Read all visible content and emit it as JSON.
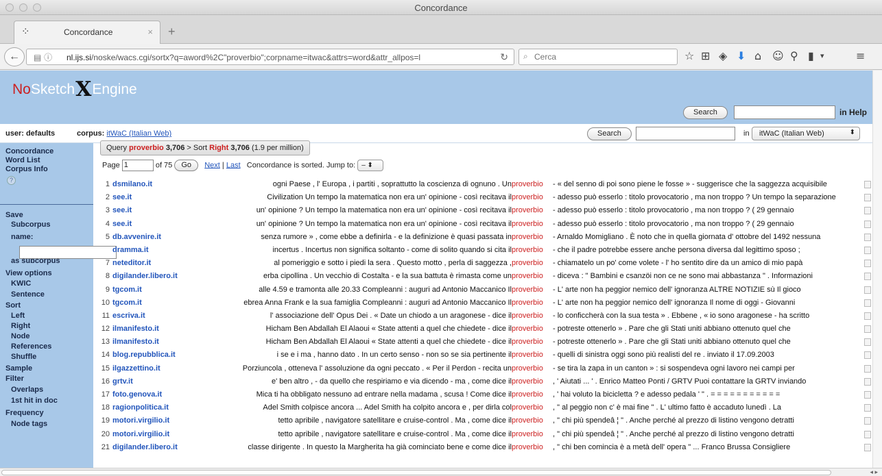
{
  "window": {
    "title": "Concordance"
  },
  "tab": {
    "favicon": "⁘",
    "label": "Concordance",
    "close": "×",
    "new": "+"
  },
  "nav": {
    "back": "←",
    "url_icons": "▤ ⓘ",
    "url_host": "nl.ijs.si",
    "url_path": "/noske/wacs.cgi/sortx?q=aword%2C\"proverbio\";corpname=itwac&attrs=word&attr_allpos=l",
    "reload": "↻",
    "search_placeholder": "Cerca",
    "search_icon": "⌕",
    "tools": [
      "☆",
      "⊞",
      "◈",
      "⬇",
      "⌂",
      "☺",
      "⚲",
      "▮",
      "▾",
      "≡"
    ]
  },
  "header": {
    "logo_no": "No",
    "logo_sketch": "Sketch",
    "logo_x": "X",
    "logo_engine": "Engine",
    "help_search_button": "Search",
    "help_label": "in Help"
  },
  "userbar": {
    "user": "user: defaults",
    "corpus_label": "corpus:",
    "corpus_name": "itWaC (Italian Web)",
    "search_button": "Search",
    "in_label": "in",
    "corpus_select": "itWaC (Italian Web)",
    "select_arrow": "⬍"
  },
  "sidebar": {
    "concordance": "Concordance",
    "word_list": "Word List",
    "corpus_info": "Corpus Info",
    "help": "?",
    "save": "Save",
    "subcorpus": "Subcorpus",
    "name": "name:",
    "as_subcorpus": "as subcorpus",
    "view_options": "View options",
    "kwic": "KWIC",
    "sentence": "Sentence",
    "sort": "Sort",
    "left": "Left",
    "right": "Right",
    "node": "Node",
    "references": "References",
    "shuffle": "Shuffle",
    "sample": "Sample",
    "filter": "Filter",
    "overlaps": "Overlaps",
    "first_hit": "1st hit in doc",
    "frequency": "Frequency",
    "node_tags": "Node tags"
  },
  "query": {
    "query_label": "Query",
    "query_word": "proverbio",
    "query_count": "3,706",
    "arrow": ">",
    "sort_label": "Sort",
    "sort_word": "Right",
    "sort_count": "3,706",
    "per_million": "(1.9 per million)"
  },
  "pager": {
    "page_label": "Page",
    "page_value": "1",
    "of_label": "of 75",
    "go": "Go",
    "next": "Next",
    "sep": "|",
    "last": "Last",
    "sorted_text": "Concordance is sorted. Jump to:",
    "jump_value": "– ⬍"
  },
  "rows": [
    {
      "n": "1",
      "ref": "dsmilano.it",
      "left": "ogni Paese , l' Europa , i partiti , soprattutto la coscienza di ognuno . Un",
      "kw": "proverbio",
      "right": "- « del senno di poi sono piene le fosse » - suggerisce che la saggezza acquisibile"
    },
    {
      "n": "2",
      "ref": "see.it",
      "left": "Civilization Un tempo la matematica non era un' opinione - così recitava il",
      "kw": "proverbio",
      "right": "- adesso può esserlo : titolo provocatorio , ma non troppo ? Un tempo la separazione"
    },
    {
      "n": "3",
      "ref": "see.it",
      "left": "un' opinione ? Un tempo la matematica non era un' opinione - così recitava il",
      "kw": "proverbio",
      "right": "- adesso può esserlo : titolo provocatorio , ma non troppo ? ( 29 gennaio"
    },
    {
      "n": "4",
      "ref": "see.it",
      "left": "un' opinione ? Un tempo la matematica non era un' opinione - così recitava il",
      "kw": "proverbio",
      "right": "- adesso può esserlo : titolo provocatorio , ma non troppo ? ( 29 gennaio"
    },
    {
      "n": "5",
      "ref": "db.avvenire.it",
      "left": "senza rumore » , come ebbe a definirla - e la definizione è quasi passata in",
      "kw": "proverbio",
      "right": "- Arnaldo Momigliano . È noto che in quella giornata d' ottobre del 1492 nessuna"
    },
    {
      "n": "",
      "ref": "dramma.it",
      "left": "incertus . Incertus non significa soltanto - come di solito quando si cita il",
      "kw": "proverbio",
      "right": "- che il padre potrebbe essere anche persona diversa dal legittimo sposo ;"
    },
    {
      "n": "7",
      "ref": "neteditor.it",
      "left": "al pomeriggio e sotto i piedi la sera . Questo motto , perla di saggezza ,",
      "kw": "proverbio",
      "right": "- chiamatelo un po' come volete - l' ho sentito dire da un amico di mio papà"
    },
    {
      "n": "8",
      "ref": "digilander.libero.it",
      "left": "erba cipollina . Un vecchio di Costalta - e la sua battuta è rimasta come un",
      "kw": "proverbio",
      "right": "- diceva : \" Bambini e csanzöi non ce ne sono mai abbastanza \" . Informazioni"
    },
    {
      "n": "9",
      "ref": "tgcom.it",
      "left": "alle 4.59 e tramonta alle 20.33 Compleanni : auguri ad Antonio Maccanico Il",
      "kw": "proverbio",
      "right": "- L' arte non ha peggior nemico dell' ignoranza ALTRE NOTIZIE sù Il gioco"
    },
    {
      "n": "10",
      "ref": "tgcom.it",
      "left": "ebrea Anna Frank e la sua famiglia Compleanni : auguri ad Antonio Maccanico Il",
      "kw": "proverbio",
      "right": "- L' arte non ha peggior nemico dell' ignoranza Il nome di oggi - Giovanni"
    },
    {
      "n": "11",
      "ref": "escriva.it",
      "left": "l' associazione dell' Opus Dei . « Date un chiodo a un aragonese - dice il",
      "kw": "proverbio",
      "right": "- lo conficcherà con la sua testa » . Ebbene , « io sono aragonese - ha scritto"
    },
    {
      "n": "12",
      "ref": "ilmanifesto.it",
      "left": "Hicham Ben Abdallah El Alaoui « State attenti a quel che chiedete - dice il",
      "kw": "proverbio",
      "right": "- potreste ottenerlo » . Pare che gli Stati uniti abbiano ottenuto quel che"
    },
    {
      "n": "13",
      "ref": "ilmanifesto.it",
      "left": "Hicham Ben Abdallah El Alaoui « State attenti a quel che chiedete - dice il",
      "kw": "proverbio",
      "right": "- potreste ottenerlo » . Pare che gli Stati uniti abbiano ottenuto quel che"
    },
    {
      "n": "14",
      "ref": "blog.repubblica.it",
      "left": "i se e i ma , hanno dato . In un certo senso - non so se sia pertinente il",
      "kw": "proverbio",
      "right": "- quelli di sinistra oggi sono più realisti del re . inviato il 17.09.2003"
    },
    {
      "n": "15",
      "ref": "ilgazzettino.it",
      "left": "Porziuncola , otteneva l' assoluzione da ogni peccato . « Per il Perdon - recita un",
      "kw": "proverbio",
      "right": "- se tira la zapa in un canton » : si sospendeva ogni lavoro nei campi per"
    },
    {
      "n": "16",
      "ref": "grtv.it",
      "left": "e' ben altro , - da quello che respiriamo e via dicendo - ma , come dice il",
      "kw": "proverbio",
      "right": ", ' Aiutati ... ' . Enrico Matteo Ponti / GRTV Puoi contattare la GRTV inviando"
    },
    {
      "n": "17",
      "ref": "foto.genova.it",
      "left": "Mica ti ha obbligato nessuno ad entrare nella madama , scusa ! Come dice il",
      "kw": "proverbio",
      "right": ", ' hai voluto la bicicletta ? e adesso pedala ' \" . = = = = = = = = = = ="
    },
    {
      "n": "18",
      "ref": "ragionpolitica.it",
      "left": "Adel Smith colpisce ancora ... Adel Smith ha colpito ancora e , per dirla col",
      "kw": "proverbio",
      "right": ", \" al peggio non c' è mai fine \" . L' ultimo fatto è accaduto lunedì . La"
    },
    {
      "n": "19",
      "ref": "motori.virgilio.it",
      "left": "tetto apribile , navigatore satellitare e cruise-control . Ma , come dice il",
      "kw": "proverbio",
      "right": ", \" chi più spendeâ ¦ \" . Anche perché al prezzo di listino vengono detratti"
    },
    {
      "n": "20",
      "ref": "motori.virgilio.it",
      "left": "tetto apribile , navigatore satellitare e cruise-control . Ma , come dice il",
      "kw": "proverbio",
      "right": ", \" chi più spendeâ ¦ \" . Anche perché al prezzo di listino vengono detratti"
    },
    {
      "n": "21",
      "ref": "digilander.libero.it",
      "left": "classe dirigente . In questo la Margherita ha già cominciato bene e come dice il",
      "kw": "proverbio",
      "right": ", \" chi ben comincia è a metà dell' opera \" ... Franco Brussa Consigliere"
    }
  ],
  "hscroll_arrows": "◂ ▸"
}
